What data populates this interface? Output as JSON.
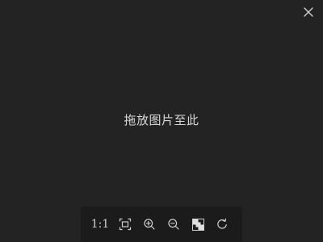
{
  "viewer": {
    "close_icon": "close-icon",
    "drop_hint": "拖放图片至此"
  },
  "toolbar": {
    "actual_size_label": "1:1",
    "tools": [
      {
        "name": "actual-size",
        "icon": "text"
      },
      {
        "name": "fit-window",
        "icon": "fit-window-icon"
      },
      {
        "name": "zoom-in",
        "icon": "zoom-in-icon"
      },
      {
        "name": "zoom-out",
        "icon": "zoom-out-icon"
      },
      {
        "name": "transparency-grid",
        "icon": "checkerboard-icon"
      },
      {
        "name": "rotate",
        "icon": "rotate-icon"
      }
    ]
  },
  "colors": {
    "background": "#232323",
    "toolbar": "#1b1b1b",
    "icon": "#cfcfcf",
    "text": "#d8d8d8"
  }
}
